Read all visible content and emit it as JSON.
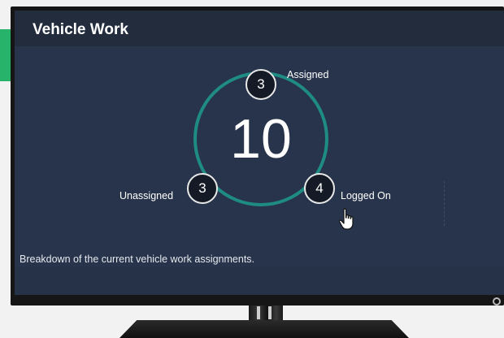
{
  "widget": {
    "title": "Vehicle Work",
    "total": "10",
    "assigned_count": "3",
    "assigned_label": "Assigned",
    "unassigned_count": "3",
    "unassigned_label": "Unassigned",
    "loggedon_count": "4",
    "loggedon_label": "Logged On",
    "description": "Breakdown of the current vehicle work assignments."
  },
  "colors": {
    "accent_ring": "#1f8c84",
    "panel_background": "#27344b",
    "header_background": "#222c3d",
    "side_tab": "#27b36a"
  },
  "icons": {
    "cursor": "hand-pointer-icon",
    "power": "power-led-icon"
  }
}
